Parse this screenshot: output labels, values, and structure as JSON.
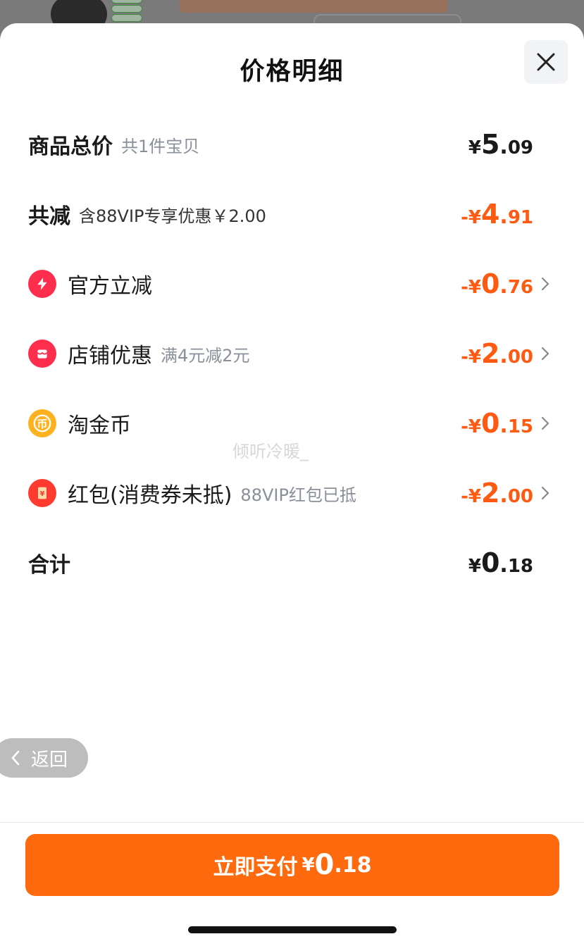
{
  "header": {
    "title": "价格明细"
  },
  "rows": {
    "total_goods": {
      "label": "商品总价",
      "note": "共1件宝贝",
      "sym": "¥",
      "int": "5",
      "dot": ".",
      "dec": "09"
    },
    "total_reduce": {
      "label": "共减",
      "note": "含88VIP专享优惠￥2.00",
      "sym": "-¥",
      "int": "4",
      "dot": ".",
      "dec": "91"
    },
    "official": {
      "label": "官方立减",
      "note": "",
      "sym": "-¥",
      "int": "0",
      "dot": ".",
      "dec": "76"
    },
    "shop": {
      "label": "店铺优惠",
      "note": "满4元减2元",
      "sym": "-¥",
      "int": "2",
      "dot": ".",
      "dec": "00"
    },
    "coins": {
      "label": "淘金币",
      "note": "",
      "sym": "-¥",
      "int": "0",
      "dot": ".",
      "dec": "15"
    },
    "redpacket": {
      "label": "红包(消费券未抵)",
      "note": "88VIP红包已抵",
      "sym": "-¥",
      "int": "2",
      "dot": ".",
      "dec": "00"
    },
    "sum": {
      "label": "合计",
      "note": "",
      "sym": "¥",
      "int": "0",
      "dot": ".",
      "dec": "18"
    }
  },
  "icons": {
    "official": "lightning-icon",
    "shop": "store-icon",
    "coins": "coin-icon",
    "redpacket": "red-envelope-icon",
    "close": "close-icon",
    "back": "chevron-left-icon"
  },
  "colors": {
    "accent": "#ff6a0f",
    "discount": "#ff5a12",
    "official_icon": "#ff2e4d",
    "shop_icon": "#ff2e4d",
    "coin_icon": "#ffb21f",
    "redpacket_icon": "#ff3b30"
  },
  "watermark": "倾听冷暖_",
  "back_button": {
    "label": "返回"
  },
  "pay_button": {
    "label": "立即支付",
    "sym": "¥",
    "int": "0",
    "dot": ".",
    "dec": "18"
  }
}
